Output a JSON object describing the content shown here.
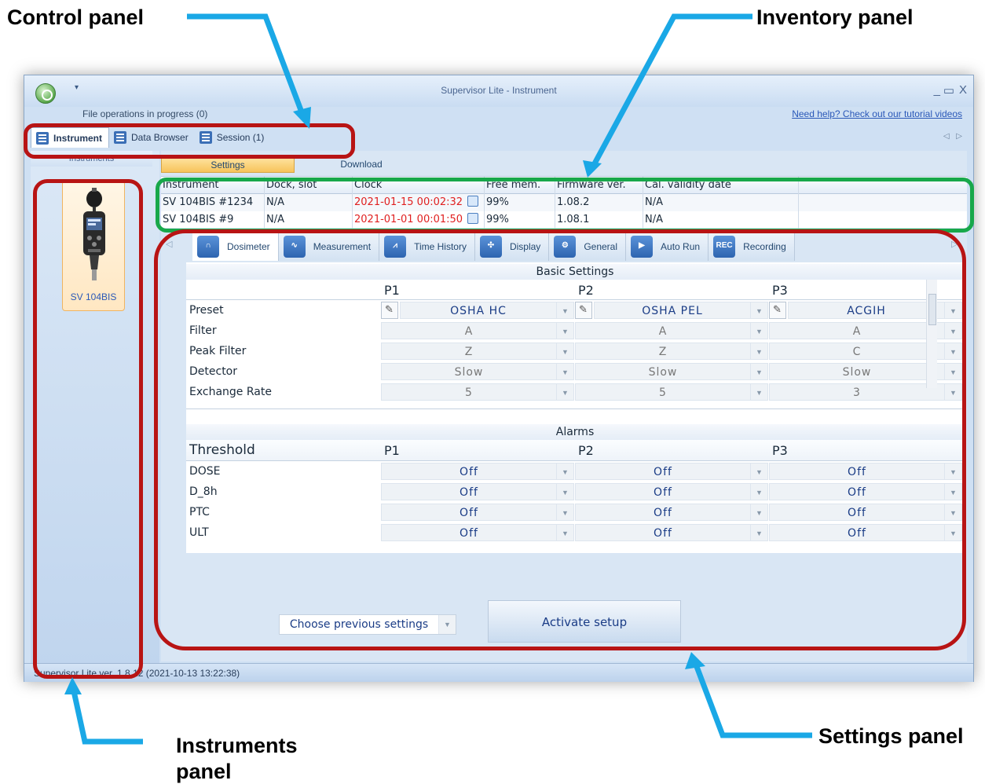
{
  "callouts": {
    "control": "Control panel",
    "inventory": "Inventory panel",
    "instruments_line1": "Instruments",
    "instruments_line2": "panel",
    "settings": "Settings panel"
  },
  "window": {
    "title": "Supervisor Lite - Instrument",
    "file_ops": "File operations in progress (0)",
    "help_link": "Need help? Check out our tutorial videos",
    "controls": {
      "minimize": "_",
      "maximize": "▭",
      "close": "X"
    }
  },
  "ribbon": {
    "tabs": [
      {
        "label": "Instrument",
        "icon": "instrument-icon"
      },
      {
        "label": "Data Browser",
        "icon": "data-browser-icon"
      },
      {
        "label": "Session (1)",
        "icon": "session-icon"
      }
    ],
    "scroll_left": "◁",
    "scroll_right": "▷"
  },
  "instruments": {
    "header": "Instruments",
    "items": [
      {
        "name": "SV 104BIS",
        "icon": "sound-level-meter-icon"
      }
    ]
  },
  "subtabs": {
    "settings": "Settings",
    "download": "Download"
  },
  "inventory": {
    "columns": [
      "Instrument",
      "Dock, slot",
      "Clock",
      "Free mem.",
      "Firmware ver.",
      "Cal. validity date"
    ],
    "rows": [
      {
        "instrument": "SV 104BIS #1234",
        "dock": "N/A",
        "clock": "2021-01-15 00:02:32",
        "mem": "99%",
        "firmware": "1.08.2",
        "cal": "N/A"
      },
      {
        "instrument": "SV 104BIS #9",
        "dock": "N/A",
        "clock": "2021-01-01 00:01:50",
        "mem": "99%",
        "firmware": "1.08.1",
        "cal": "N/A"
      }
    ]
  },
  "setting_tabs": [
    {
      "label": "Dosimeter",
      "icon": "headphones-icon"
    },
    {
      "label": "Measurement",
      "icon": "waveform-icon"
    },
    {
      "label": "Time History",
      "icon": "line-chart-icon"
    },
    {
      "label": "Display",
      "icon": "display-icon"
    },
    {
      "label": "General",
      "icon": "gears-icon"
    },
    {
      "label": "Auto Run",
      "icon": "play-icon"
    },
    {
      "label": "Recording",
      "icon": "rec-icon",
      "badge": "REC"
    }
  ],
  "basic": {
    "title": "Basic Settings",
    "profiles": [
      "P1",
      "P2",
      "P3"
    ],
    "rows": [
      {
        "label": "Preset",
        "values": [
          "OSHA HC",
          "OSHA PEL",
          "ACGIH"
        ]
      },
      {
        "label": "Filter",
        "values": [
          "A",
          "A",
          "A"
        ]
      },
      {
        "label": "Peak Filter",
        "values": [
          "Z",
          "Z",
          "C"
        ]
      },
      {
        "label": "Detector",
        "values": [
          "Slow",
          "Slow",
          "Slow"
        ]
      },
      {
        "label": "Exchange Rate",
        "values": [
          "5",
          "5",
          "3"
        ]
      }
    ]
  },
  "alarms": {
    "title": "Alarms",
    "first_col": "Threshold",
    "profiles": [
      "P1",
      "P2",
      "P3"
    ],
    "rows": [
      {
        "label": "DOSE",
        "values": [
          "Off",
          "Off",
          "Off"
        ]
      },
      {
        "label": "D_8h",
        "values": [
          "Off",
          "Off",
          "Off"
        ]
      },
      {
        "label": "PTC",
        "values": [
          "Off",
          "Off",
          "Off"
        ]
      },
      {
        "label": "ULT",
        "values": [
          "Off",
          "Off",
          "Off"
        ]
      }
    ]
  },
  "actions": {
    "previous": "Choose previous settings",
    "activate": "Activate setup"
  },
  "status": "Supervisor Lite ver. 1.8.12 (2021-10-13 13:22:38)",
  "colors": {
    "ring_red": "#b81414",
    "ring_green": "#18a84a",
    "arrow_blue": "#1aa8e6",
    "clock_red": "#e02020"
  }
}
